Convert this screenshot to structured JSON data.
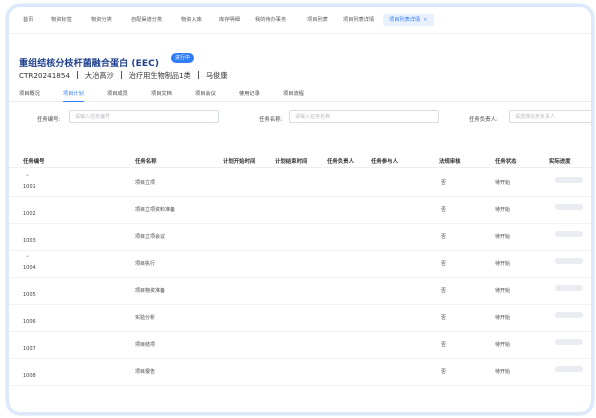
{
  "top_tabs": [
    {
      "label": "首页",
      "active": false
    },
    {
      "label": "物资标签",
      "active": false
    },
    {
      "label": "物资分类",
      "active": false
    },
    {
      "label": "自配渠道分类",
      "active": false
    },
    {
      "label": "物资入库",
      "active": false
    },
    {
      "label": "库存明细",
      "active": false
    },
    {
      "label": "我的待办事务",
      "active": false
    },
    {
      "label": "项目列表",
      "active": false
    },
    {
      "label": "项目列表详情",
      "active": false
    },
    {
      "label": "项目列表详情",
      "active": true
    }
  ],
  "project": {
    "title": "重组结核分枝杆菌融合蛋白 (EEC)",
    "status": "进行中",
    "code": "CTR20241854",
    "company": "大冶高沙",
    "category": "治疗用生物制品1类",
    "person": "马俊康"
  },
  "sub_tabs": [
    {
      "label": "项目概况",
      "active": false
    },
    {
      "label": "项目计划",
      "active": true
    },
    {
      "label": "项目成员",
      "active": false
    },
    {
      "label": "项目文档",
      "active": false
    },
    {
      "label": "项目会议",
      "active": false
    },
    {
      "label": "使用记录",
      "active": false
    },
    {
      "label": "项目流程",
      "active": false
    }
  ],
  "filters": [
    {
      "label": "任务编号:",
      "placeholder": "请输入任务编号"
    },
    {
      "label": "任务名称:",
      "placeholder": "请输入任务名称"
    },
    {
      "label": "任务负责人:",
      "placeholder": "请选择任务负责人"
    }
  ],
  "table": {
    "columns": [
      "任务编号",
      "任务名称",
      "计划开始时间",
      "计划结束时间",
      "任务负责人",
      "任务参与人",
      "法规审核",
      "任务状态",
      "实际进度"
    ],
    "rows": [
      {
        "code": "1001",
        "name": "项目立项",
        "review": "否",
        "status": "待开始",
        "expand": true
      },
      {
        "code": "1002",
        "name": "项目立项资料准备",
        "review": "否",
        "status": "待开始",
        "expand": false
      },
      {
        "code": "1003",
        "name": "项目立项会议",
        "review": "否",
        "status": "待开始",
        "expand": false
      },
      {
        "code": "1004",
        "name": "项目执行",
        "review": "否",
        "status": "待开始",
        "expand": true
      },
      {
        "code": "1005",
        "name": "项目物资准备",
        "review": "否",
        "status": "待开始",
        "expand": false
      },
      {
        "code": "1006",
        "name": "实验分析",
        "review": "否",
        "status": "待开始",
        "expand": false
      },
      {
        "code": "1007",
        "name": "项目结项",
        "review": "否",
        "status": "待开始",
        "expand": false
      },
      {
        "code": "1008",
        "name": "项目报告",
        "review": "否",
        "status": "待开始",
        "expand": false
      }
    ]
  }
}
